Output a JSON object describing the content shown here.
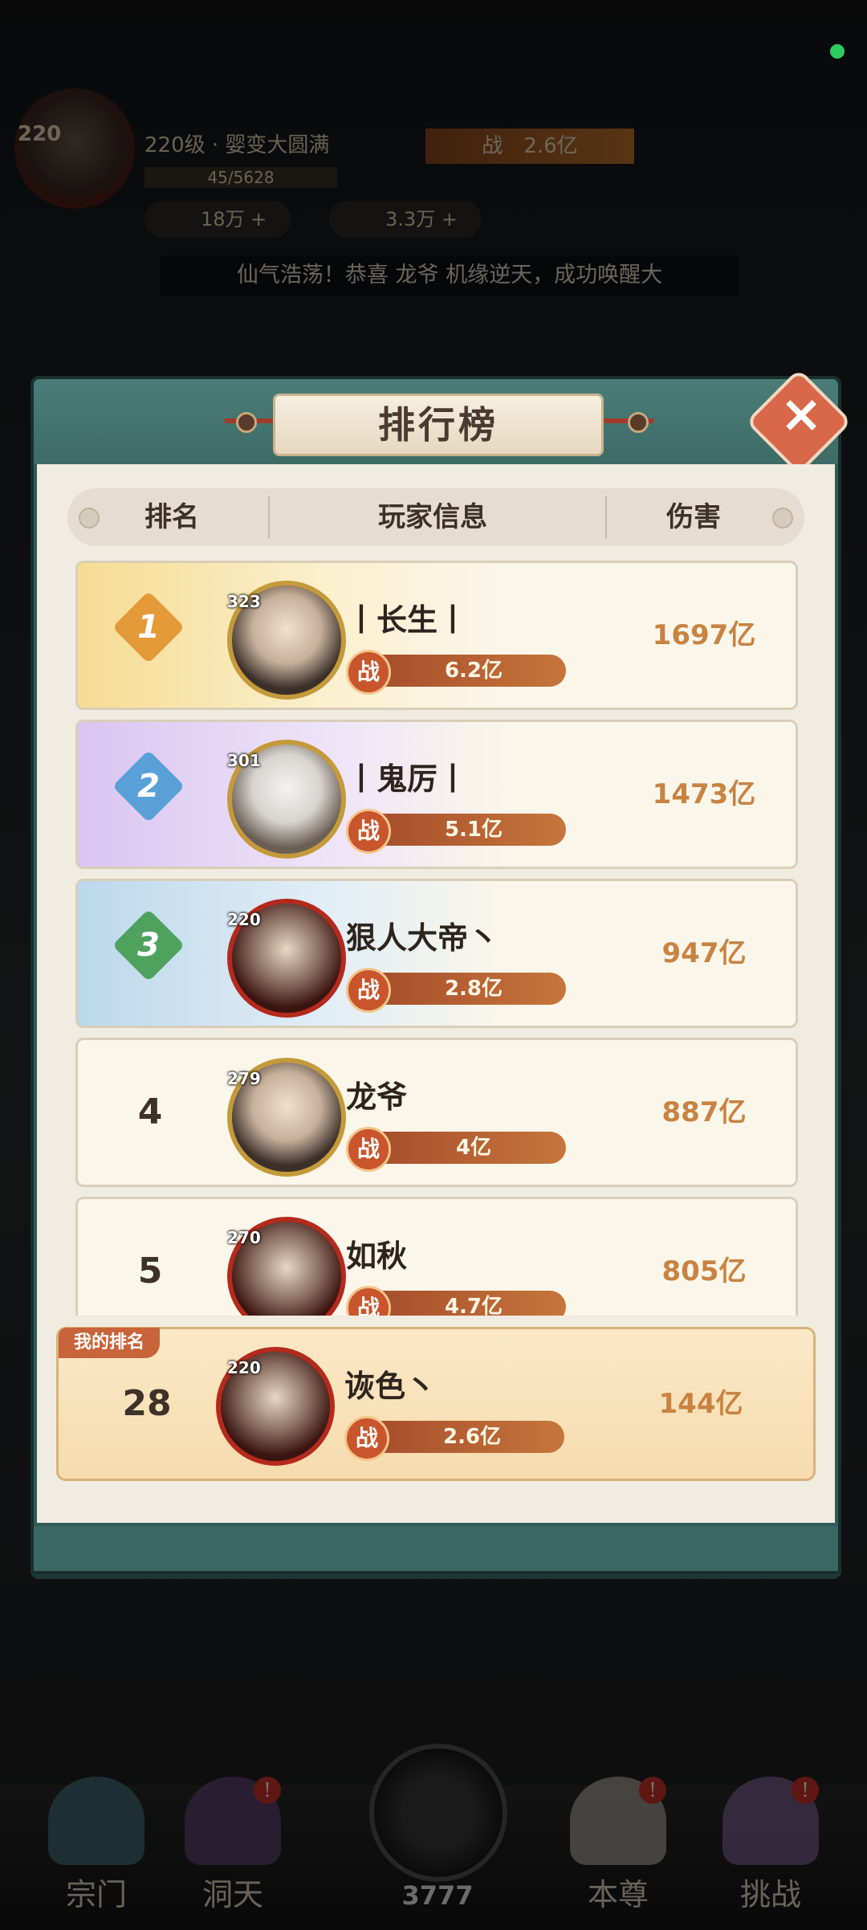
{
  "hud": {
    "level_badge": "220",
    "level_title": "220级 · 婴变大圆满",
    "exp": "45/5628",
    "gems": "18万",
    "currency": "3.3万",
    "power_label": "战",
    "power": "2.6亿",
    "banner": "仙气浩荡！恭喜 龙爷 机缘逆天，成功唤醒大"
  },
  "panel": {
    "title": "排行榜",
    "columns": [
      "排名",
      "玩家信息",
      "伤害"
    ],
    "power_label": "战",
    "rows": [
      {
        "rank": "1",
        "level": "323",
        "name": "丨长生丨",
        "power": "6.2亿",
        "damage": "1697亿"
      },
      {
        "rank": "2",
        "level": "301",
        "name": "丨鬼厉丨",
        "power": "5.1亿",
        "damage": "1473亿"
      },
      {
        "rank": "3",
        "level": "220",
        "name": "狠人大帝丶",
        "power": "2.8亿",
        "damage": "947亿"
      },
      {
        "rank": "4",
        "level": "279",
        "name": "龙爷",
        "power": "4亿",
        "damage": "887亿"
      },
      {
        "rank": "5",
        "level": "270",
        "name": "如秋",
        "power": "4.7亿",
        "damage": "805亿"
      }
    ],
    "my_rank": {
      "tag": "我的排名",
      "rank": "28",
      "level": "220",
      "name": "诙色丶",
      "power": "2.6亿",
      "damage": "144亿"
    }
  },
  "nav": {
    "items": [
      "宗门",
      "洞天",
      "本尊",
      "挑战"
    ],
    "center_count": "3777"
  },
  "colors": {
    "medal1": "#e59a3a",
    "medal2": "#5aa0d8",
    "medal3": "#4fa25e"
  }
}
